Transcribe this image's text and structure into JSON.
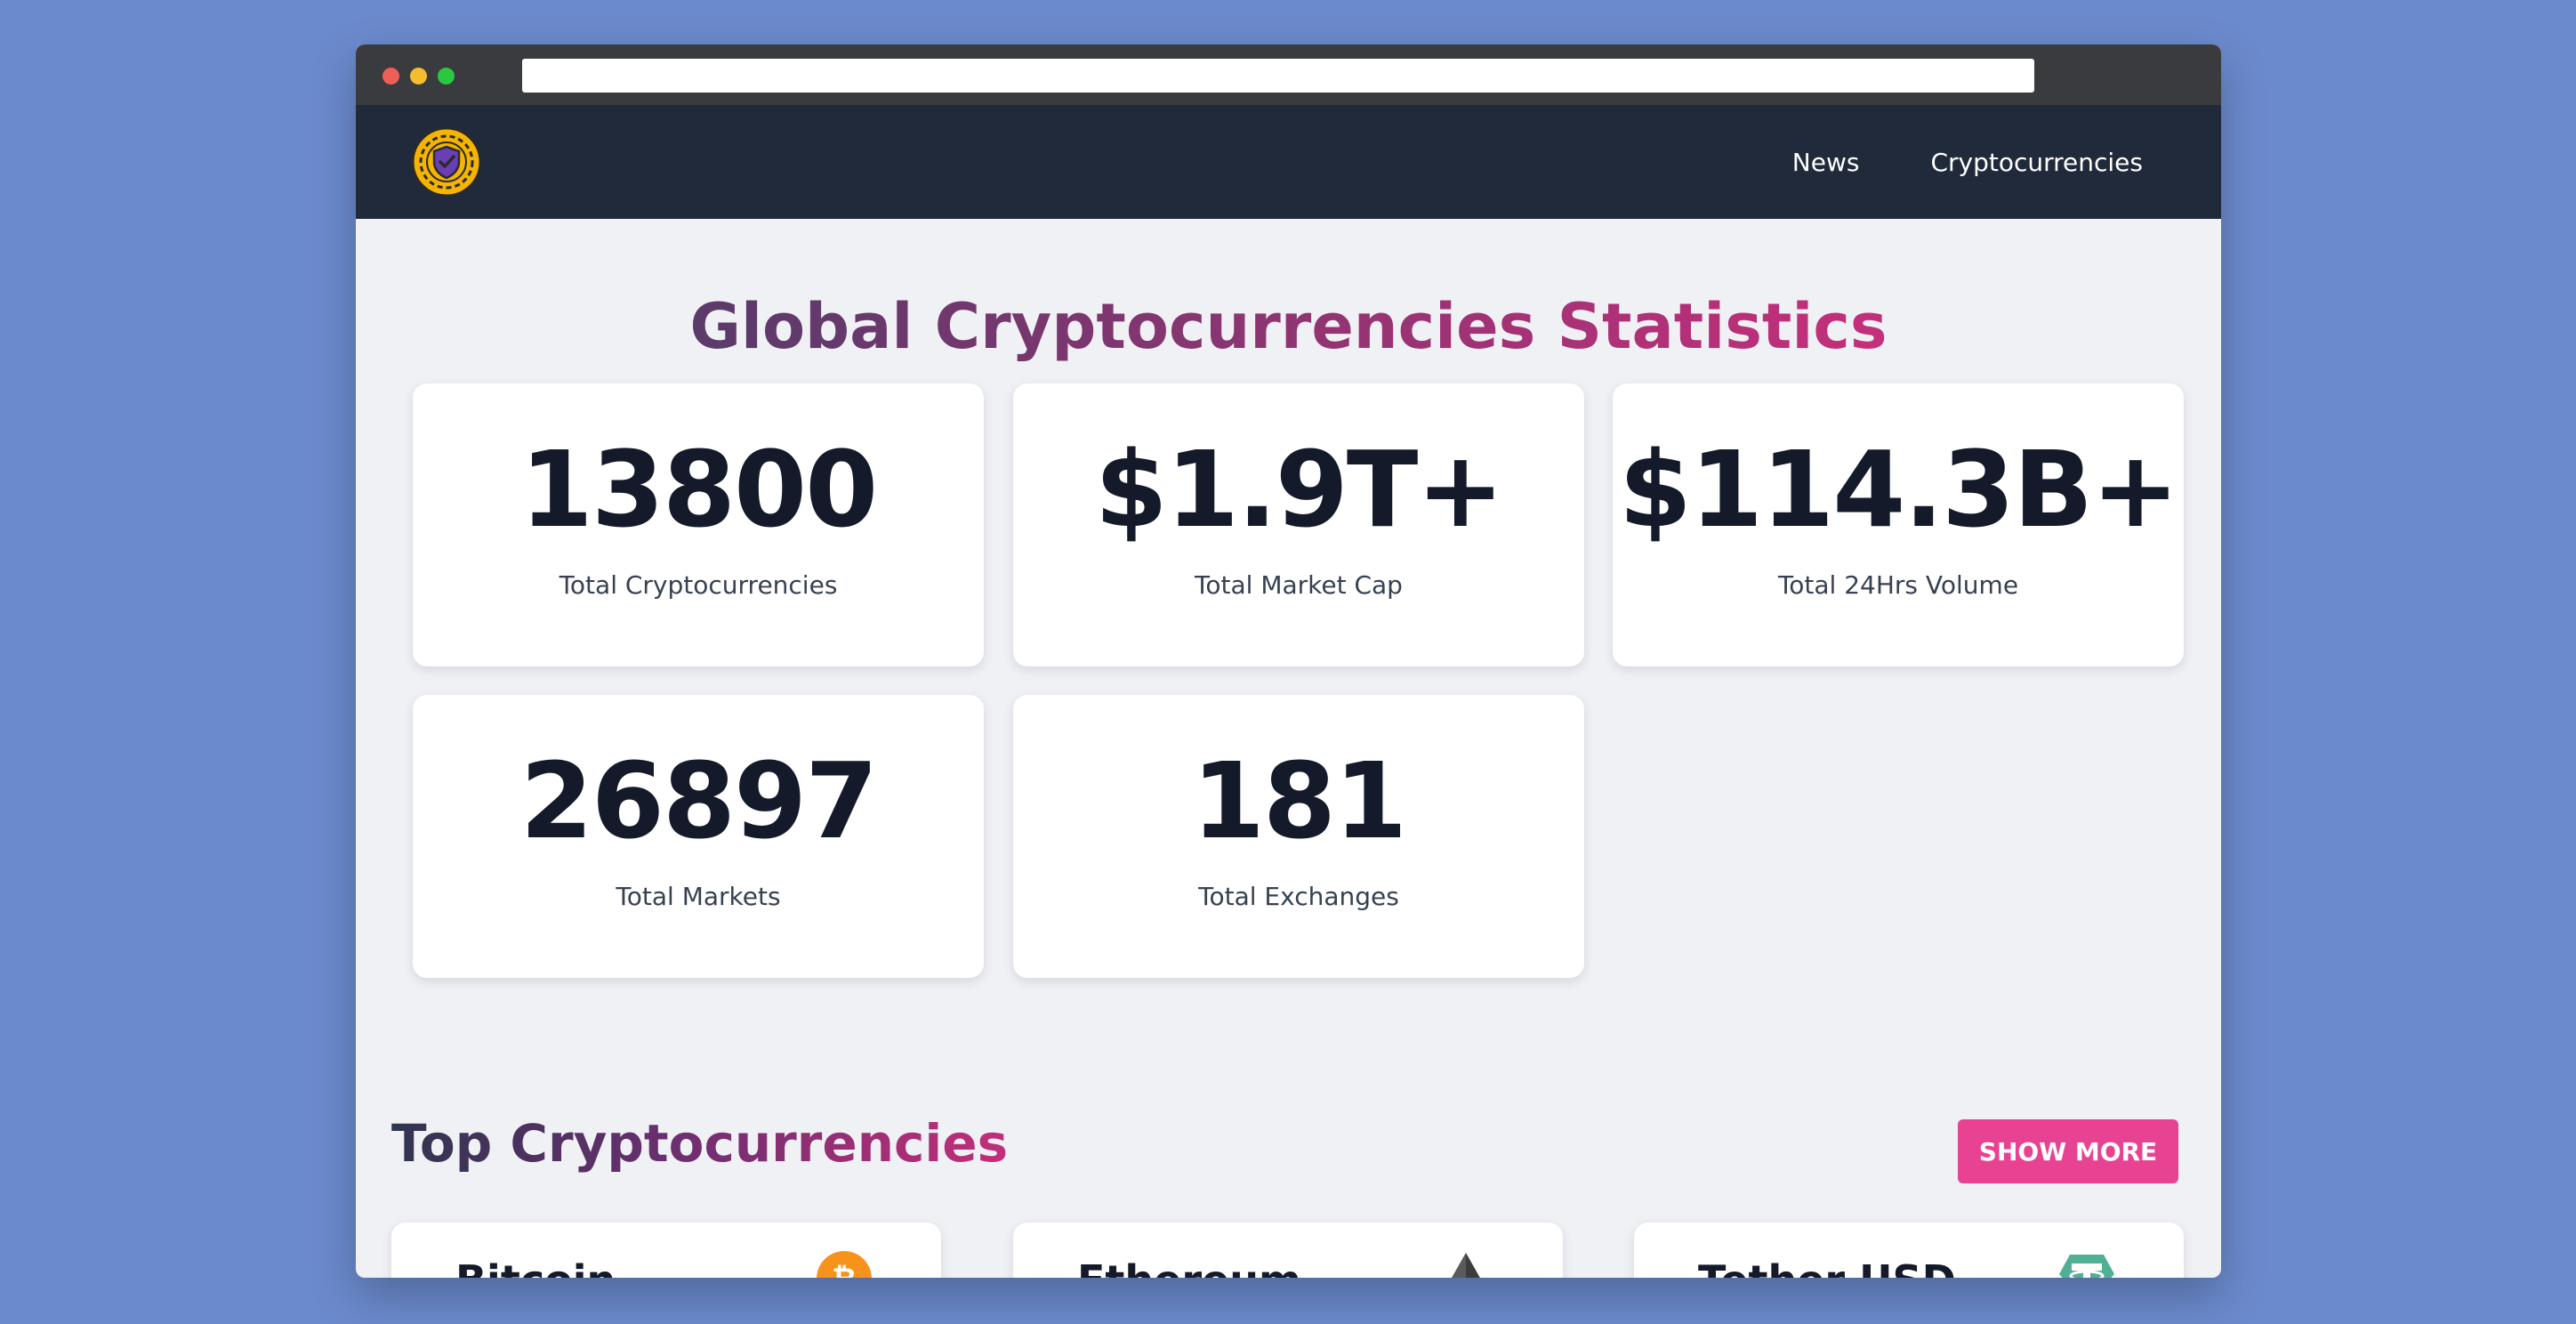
{
  "nav": {
    "logo_icon": "shield-check-icon",
    "links": [
      "News",
      "Cryptocurrencies"
    ]
  },
  "stats": {
    "heading_part1": "Global Cryptocurrencies Statistics",
    "cards": [
      {
        "value": "13800",
        "label": "Total Cryptocurrencies"
      },
      {
        "value": "$1.9T+",
        "label": "Total Market Cap"
      },
      {
        "value": "$114.3B+",
        "label": "Total 24Hrs Volume"
      },
      {
        "value": "26897",
        "label": "Total Markets"
      },
      {
        "value": "181",
        "label": "Total Exchanges"
      }
    ]
  },
  "top": {
    "title": "Top Cryptocurrencies",
    "show_more": "SHOW MORE",
    "coins": [
      {
        "name": "Bitcoin",
        "icon": "bitcoin-icon",
        "color": "#f7931a"
      },
      {
        "name": "Ethereum",
        "icon": "ethereum-icon",
        "color": "#3c3c3d"
      },
      {
        "name": "Tether USD",
        "icon": "tether-icon",
        "color": "#50af95"
      }
    ]
  },
  "colors": {
    "navbar": "#212a3b",
    "accent": "#e84393",
    "background": "#6b8acd"
  }
}
